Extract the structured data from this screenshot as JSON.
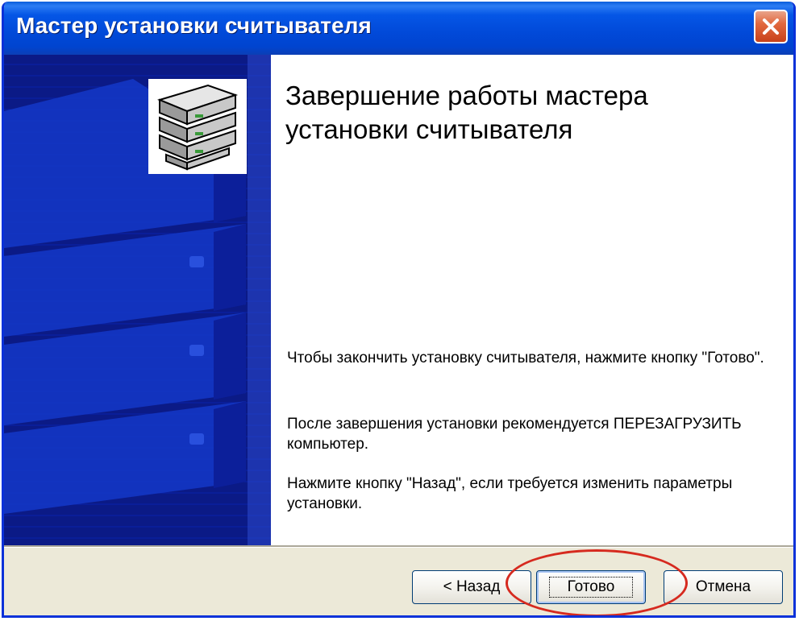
{
  "window": {
    "title": "Мастер установки считывателя",
    "close_icon": "close-x-icon"
  },
  "side_panel": {
    "icon": "server-stack-icon",
    "background_color": "#0b1a86"
  },
  "main": {
    "heading": "Завершение работы мастера установки считывателя",
    "paragraphs": [
      "Чтобы закончить установку считывателя, нажмите кнопку \"Готово\".",
      "После завершения установки рекомендуется ПЕРЕЗАГРУЗИТЬ компьютер.",
      "Нажмите кнопку \"Назад\", если требуется изменить параметры установки."
    ]
  },
  "buttons": {
    "back": "< Назад",
    "finish": "Готово",
    "cancel": "Отмена"
  },
  "colors": {
    "titlebar": "#0054e3",
    "annotation": "#d62a1f"
  }
}
